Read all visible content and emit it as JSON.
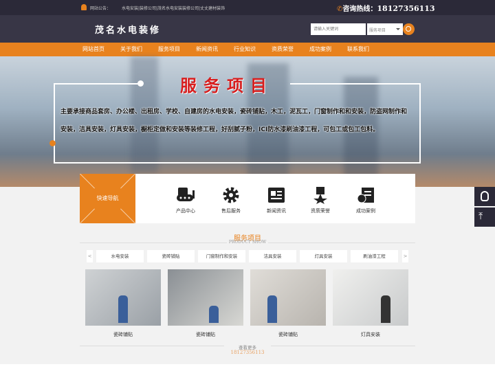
{
  "topbar": {
    "notice_label": "网站公告：",
    "notice_text": "水电安装|装修公司|茂名水电安装装修公司|丈丈建材装饰",
    "hotline_label": "咨询热线：",
    "hotline": "18127356113"
  },
  "header": {
    "logo": "茂名水电装修",
    "search_placeholder": "请输入关键词",
    "select_value": "服务项目"
  },
  "nav": [
    "网站首页",
    "关于我们",
    "服务项目",
    "新闻资讯",
    "行业知识",
    "资质荣誉",
    "成功案例",
    "联系我们"
  ],
  "banner": {
    "title": "服务项目",
    "text": "主要承接商品套房、办公楼、出租房、学校、自建房的水电安装，瓷砖铺贴，木工，泥瓦工，门窗制作和和安装，防盗网制作和安装，洁具安装，灯具安装，橱柜定做和安装等装修工程，好刮腻子粉，ICI防水漆刷油漆工程，可包工或包工包料。"
  },
  "quick_nav": {
    "title": "快速导航",
    "items": [
      {
        "label": "产品中心",
        "icon": "bulldozer-icon"
      },
      {
        "label": "售后服务",
        "icon": "gear-icon"
      },
      {
        "label": "新闻资讯",
        "icon": "newspaper-icon"
      },
      {
        "label": "资质荣誉",
        "icon": "medal-icon"
      },
      {
        "label": "成功案例",
        "icon": "case-book-icon"
      }
    ]
  },
  "section": {
    "title": "服务项目",
    "subtitle": "PRODUCT SHOW",
    "tabs": [
      "水电安装",
      "瓷砖铺贴",
      "门窗制作和安装",
      "洁具安装",
      "灯具安装",
      "刷油漆工程"
    ],
    "prev": "<",
    "next": ">",
    "products": [
      "瓷砖铺贴",
      "瓷砖铺贴",
      "瓷砖铺贴",
      "灯具安装"
    ],
    "more": "查看更多",
    "phone": "18127356113"
  },
  "colors": {
    "accent": "#e8821e",
    "dark": "#2b2938",
    "title_red": "#d81e1e"
  }
}
